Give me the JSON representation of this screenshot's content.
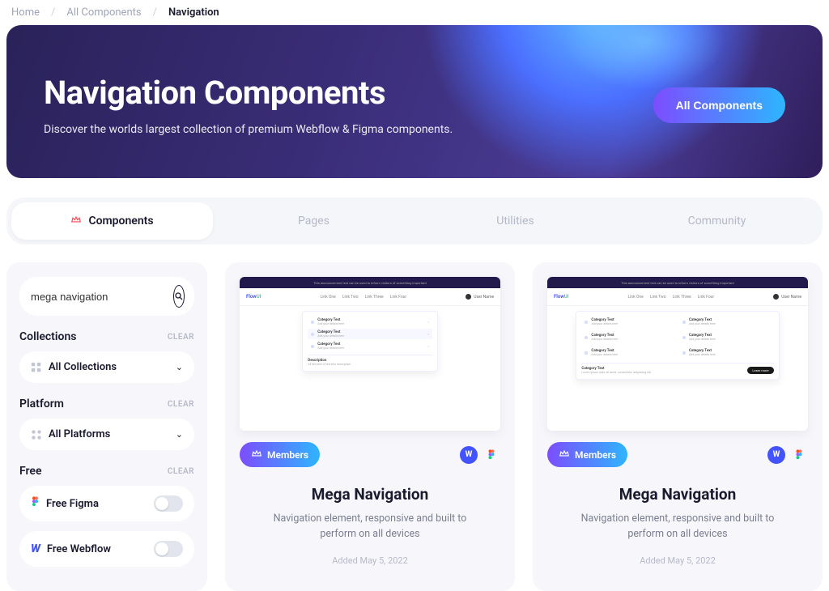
{
  "breadcrumb": {
    "home": "Home",
    "all": "All Components",
    "current": "Navigation"
  },
  "hero": {
    "title": "Navigation Components",
    "subtitle": "Discover the worlds largest collection of premium Webflow & Figma components.",
    "cta": "All Components"
  },
  "tabs": {
    "components": "Components",
    "pages": "Pages",
    "utilities": "Utilities",
    "community": "Community"
  },
  "sidebar": {
    "search_value": "mega navigation",
    "clear": "CLEAR",
    "collections": {
      "label": "Collections",
      "select": "All Collections"
    },
    "platform": {
      "label": "Platform",
      "select": "All Platforms"
    },
    "free": {
      "label": "Free",
      "figma": "Free Figma",
      "webflow": "Free Webflow"
    }
  },
  "cards": [
    {
      "badge": "Members",
      "title": "Mega Navigation",
      "desc": "Navigation element, responsive and built to perform on all devices",
      "date": "Added May 5, 2022"
    },
    {
      "badge": "Members",
      "title": "Mega Navigation",
      "desc": "Navigation element, responsive and built to perform on all devices",
      "date": "Added May 5, 2022"
    }
  ],
  "preview": {
    "brand": "Flow",
    "links": [
      "Link One",
      "Link Two",
      "Link Three",
      "Link Four"
    ],
    "user": "User Name",
    "cat": "Category Text",
    "sub": "Add your details here",
    "desc_label": "Description",
    "foot_btn": "Learn more"
  }
}
